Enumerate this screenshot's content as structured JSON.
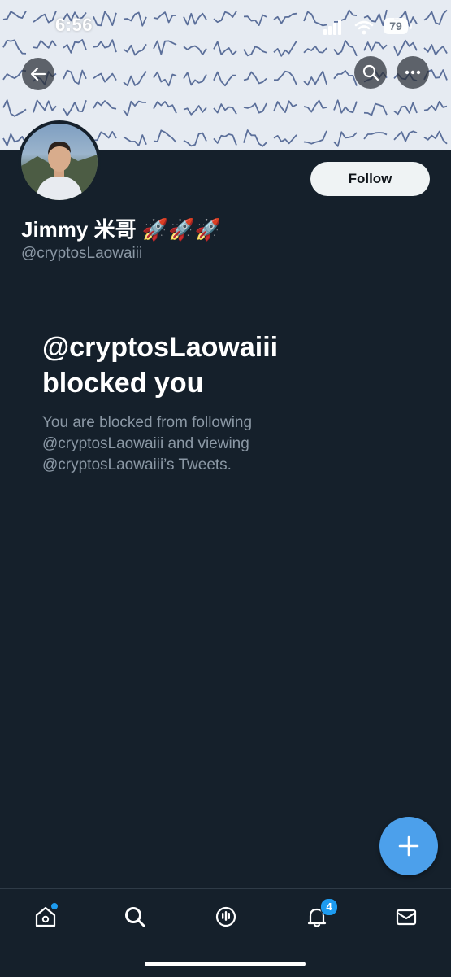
{
  "status_bar": {
    "time": "6:56",
    "battery": "79"
  },
  "header": {
    "back_icon": "arrow-left-icon",
    "search_icon": "search-icon",
    "more_icon": "more-horizontal-icon"
  },
  "profile": {
    "display_name": "Jimmy 米哥 🚀🚀🚀",
    "handle": "@cryptosLaowaiii",
    "follow_label": "Follow"
  },
  "blocked": {
    "title_line1": "@cryptosLaowaiii",
    "title_line2": "blocked you",
    "description": "You are blocked from following @cryptosLaowaiii and viewing @cryptosLaowaiii’s Tweets."
  },
  "fab": {
    "icon": "plus-icon"
  },
  "bottom_nav": {
    "items": [
      {
        "name": "home",
        "icon": "home-icon",
        "has_dot": true
      },
      {
        "name": "search",
        "icon": "search-icon"
      },
      {
        "name": "spaces",
        "icon": "spaces-icon"
      },
      {
        "name": "notifications",
        "icon": "bell-icon",
        "badge": "4"
      },
      {
        "name": "messages",
        "icon": "mail-icon"
      }
    ]
  },
  "colors": {
    "background": "#15202b",
    "accent": "#1d9bf0",
    "fab": "#4ca0eb",
    "muted_text": "#8b98a5"
  }
}
